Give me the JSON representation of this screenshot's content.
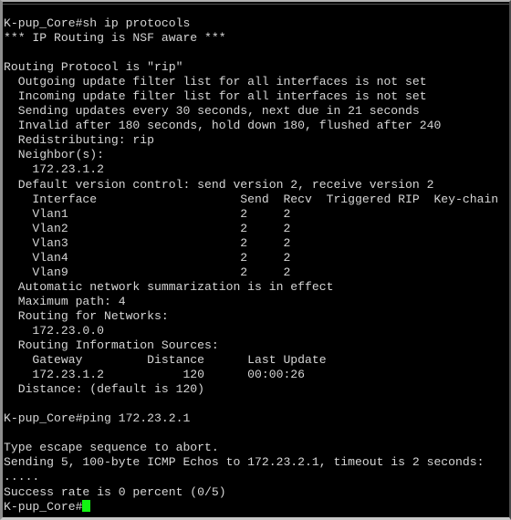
{
  "window": {
    "kind": "terminal-console",
    "background_color": "#000000",
    "text_color": "#d6d6d6",
    "cursor_color": "#12f412",
    "frame_color": "#b0b0b0",
    "device_hostname": "K-pup_Core",
    "prompt_suffix": "#"
  },
  "console": {
    "lines": [
      "K-pup_Core#sh ip protocols",
      "*** IP Routing is NSF aware ***",
      "",
      "Routing Protocol is \"rip\"",
      "  Outgoing update filter list for all interfaces is not set",
      "  Incoming update filter list for all interfaces is not set",
      "  Sending updates every 30 seconds, next due in 21 seconds",
      "  Invalid after 180 seconds, hold down 180, flushed after 240",
      "  Redistributing: rip",
      "  Neighbor(s):",
      "    172.23.1.2",
      "  Default version control: send version 2, receive version 2",
      "    Interface                    Send  Recv  Triggered RIP  Key-chain",
      "    Vlan1                        2     2",
      "    Vlan2                        2     2",
      "    Vlan3                        2     2",
      "    Vlan4                        2     2",
      "    Vlan9                        2     2",
      "  Automatic network summarization is in effect",
      "  Maximum path: 4",
      "  Routing for Networks:",
      "    172.23.0.0",
      "  Routing Information Sources:",
      "    Gateway         Distance      Last Update",
      "    172.23.1.2           120      00:00:26",
      "  Distance: (default is 120)",
      "",
      "K-pup_Core#ping 172.23.2.1",
      "",
      "Type escape sequence to abort.",
      "Sending 5, 100-byte ICMP Echos to 172.23.2.1, timeout is 2 seconds:",
      ".....",
      "Success rate is 0 percent (0/5)"
    ],
    "final_prompt": "K-pup_Core#"
  },
  "commands": {
    "show_ip_protocols": "sh ip protocols",
    "ping": "ping 172.23.2.1"
  },
  "rip_summary": {
    "nsf_banner": "*** IP Routing is NSF aware ***",
    "protocol": "rip",
    "outgoing_filter": "not set",
    "incoming_filter": "not set",
    "update_interval_seconds": "30",
    "next_due_seconds": "21",
    "invalid_after_seconds": "180",
    "hold_down_seconds": "180",
    "flushed_after_seconds": "240",
    "redistributing": "rip",
    "neighbors": [
      "172.23.1.2"
    ],
    "default_version_send": "2",
    "default_version_receive": "2",
    "auto_summarization": "in effect",
    "maximum_path": "4",
    "networks": [
      "172.23.0.0"
    ],
    "distance_default": "120"
  },
  "interface_table": {
    "headers": [
      "Interface",
      "Send",
      "Recv",
      "Triggered RIP",
      "Key-chain"
    ],
    "rows": [
      {
        "interface": "Vlan1",
        "send": "2",
        "recv": "2",
        "triggered_rip": "",
        "key_chain": ""
      },
      {
        "interface": "Vlan2",
        "send": "2",
        "recv": "2",
        "triggered_rip": "",
        "key_chain": ""
      },
      {
        "interface": "Vlan3",
        "send": "2",
        "recv": "2",
        "triggered_rip": "",
        "key_chain": ""
      },
      {
        "interface": "Vlan4",
        "send": "2",
        "recv": "2",
        "triggered_rip": "",
        "key_chain": ""
      },
      {
        "interface": "Vlan9",
        "send": "2",
        "recv": "2",
        "triggered_rip": "",
        "key_chain": ""
      }
    ]
  },
  "routing_information_sources": {
    "headers": [
      "Gateway",
      "Distance",
      "Last Update"
    ],
    "rows": [
      {
        "gateway": "172.23.1.2",
        "distance": "120",
        "last_update": "00:00:26"
      }
    ]
  },
  "ping_result": {
    "target": "172.23.2.1",
    "abort_hint": "Type escape sequence to abort.",
    "sending_line": "Sending 5, 100-byte ICMP Echos to 172.23.2.1, timeout is 2 seconds:",
    "count": "5",
    "packet_size": "100-byte",
    "timeout_seconds": "2",
    "replies": ".....",
    "success_rate_line": "Success rate is 0 percent (0/5)",
    "success_percent": "0",
    "received": "0",
    "sent": "5"
  }
}
